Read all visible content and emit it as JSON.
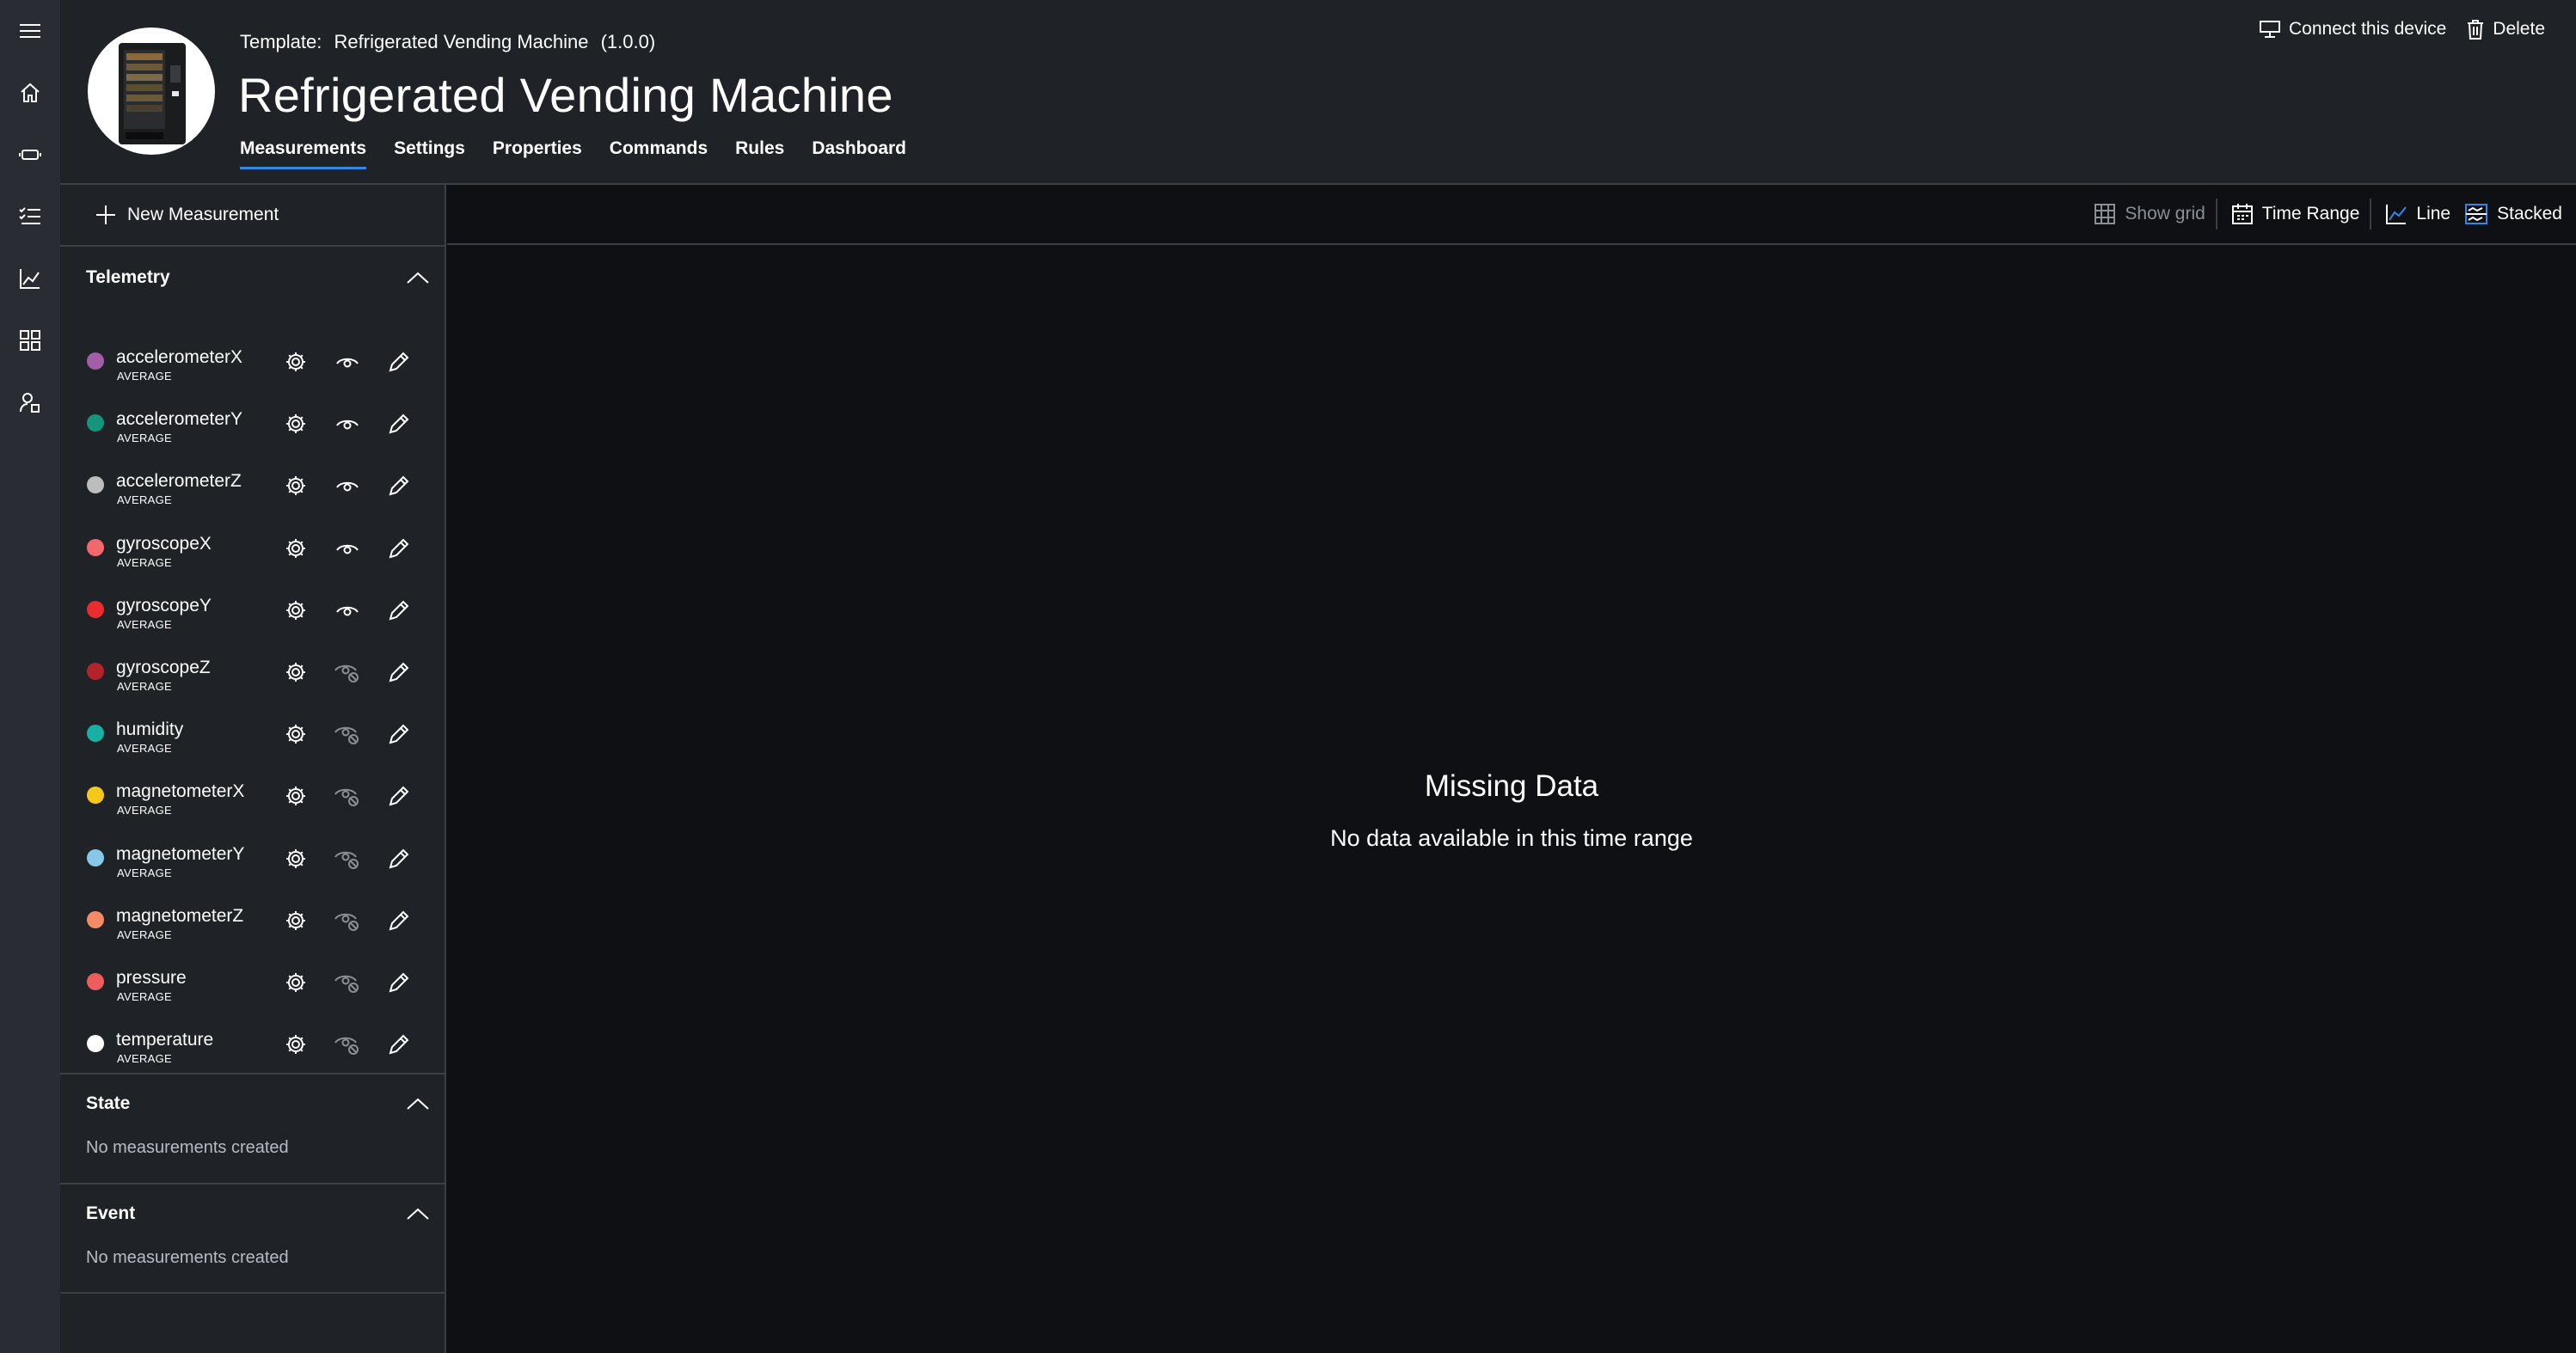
{
  "header": {
    "template_label": "Template:",
    "template_name": "Refrigerated Vending Machine",
    "template_version": "(1.0.0)",
    "title": "Refrigerated Vending Machine",
    "tabs": [
      {
        "label": "Measurements",
        "active": true
      },
      {
        "label": "Settings"
      },
      {
        "label": "Properties"
      },
      {
        "label": "Commands"
      },
      {
        "label": "Rules"
      },
      {
        "label": "Dashboard"
      }
    ],
    "actions": {
      "connect": "Connect this device",
      "delete": "Delete"
    }
  },
  "rail": {
    "icons": [
      "hamburger-icon",
      "home-icon",
      "device-icon",
      "rules-list-icon",
      "analytics-icon",
      "dashboard-grid-icon",
      "admin-user-icon"
    ]
  },
  "measurements": {
    "new_label": "New Measurement",
    "telemetry": {
      "title": "Telemetry",
      "items": [
        {
          "name": "accelerometerX",
          "agg": "AVERAGE",
          "color": "#a25fa8",
          "visible": true
        },
        {
          "name": "accelerometerY",
          "agg": "AVERAGE",
          "color": "#15957c",
          "visible": true
        },
        {
          "name": "accelerometerZ",
          "agg": "AVERAGE",
          "color": "#bdbdbd",
          "visible": true
        },
        {
          "name": "gyroscopeX",
          "agg": "AVERAGE",
          "color": "#f3686c",
          "visible": true
        },
        {
          "name": "gyroscopeY",
          "agg": "AVERAGE",
          "color": "#e82c30",
          "visible": true
        },
        {
          "name": "gyroscopeZ",
          "agg": "AVERAGE",
          "color": "#b3232a",
          "visible": false
        },
        {
          "name": "humidity",
          "agg": "AVERAGE",
          "color": "#17b0a3",
          "visible": false
        },
        {
          "name": "magnetometerX",
          "agg": "AVERAGE",
          "color": "#f5c91c",
          "visible": false
        },
        {
          "name": "magnetometerY",
          "agg": "AVERAGE",
          "color": "#86c7ea",
          "visible": false
        },
        {
          "name": "magnetometerZ",
          "agg": "AVERAGE",
          "color": "#f58a66",
          "visible": false
        },
        {
          "name": "pressure",
          "agg": "AVERAGE",
          "color": "#ee5d5d",
          "visible": false
        },
        {
          "name": "temperature",
          "agg": "AVERAGE",
          "color": "#ffffff",
          "visible": false
        }
      ]
    },
    "state": {
      "title": "State",
      "empty": "No measurements created"
    },
    "event": {
      "title": "Event",
      "empty": "No measurements created"
    }
  },
  "chart_toolbar": {
    "show_grid": "Show grid",
    "time_range": "Time Range",
    "line": "Line",
    "stacked": "Stacked"
  },
  "chart": {
    "empty_title": "Missing Data",
    "empty_subtitle": "No data available in this time range"
  },
  "colors": {
    "accent": "#2f87e6",
    "rail_bg": "#292d33",
    "panel_bg": "#1f2226",
    "canvas_bg": "#0e1013"
  }
}
